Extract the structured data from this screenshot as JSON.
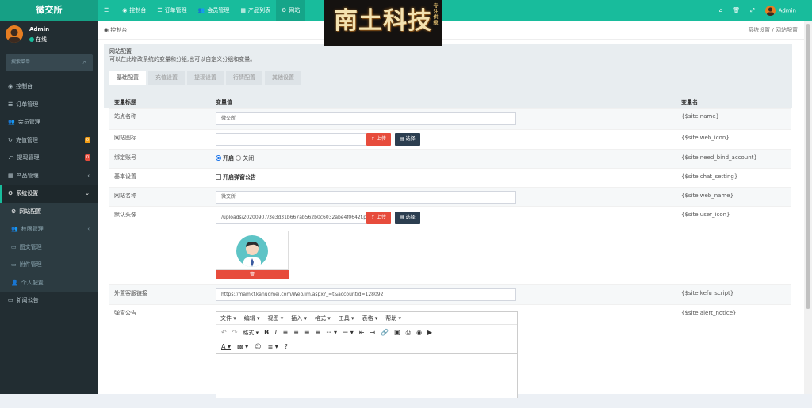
{
  "brand": "微交所",
  "topnav": [
    {
      "icon": "☰",
      "icon_name": "menu-toggle-icon",
      "label": ""
    },
    {
      "icon": "◉",
      "icon_name": "dashboard-icon",
      "label": "控制台"
    },
    {
      "icon": "☰",
      "icon_name": "order-list-icon",
      "label": "订单管理"
    },
    {
      "icon": "👥",
      "icon_name": "users-icon",
      "label": "会员管理"
    },
    {
      "icon": "▦",
      "icon_name": "product-icon",
      "label": "产品列表"
    },
    {
      "icon": "⚙",
      "icon_name": "gear-icon",
      "label": "网站"
    }
  ],
  "topright": {
    "home": "⌂",
    "trash": "🗑",
    "expand": "⤢",
    "user": "Admin"
  },
  "logo_overlay": {
    "text": "南土科技",
    "small": "专注供级"
  },
  "sidebar": {
    "user_name": "Admin",
    "user_status": "在线",
    "search_placeholder": "搜索菜单",
    "items": [
      {
        "icon": "◉",
        "icon_name": "dashboard-icon",
        "label": "控制台"
      },
      {
        "icon": "☰",
        "icon_name": "list-icon",
        "label": "订单管理"
      },
      {
        "icon": "👥",
        "icon_name": "users-icon",
        "label": "会员管理"
      },
      {
        "icon": "↻",
        "icon_name": "recharge-icon",
        "label": "充值管理",
        "badge": "0"
      },
      {
        "icon": "⤺",
        "icon_name": "withdraw-icon",
        "label": "提现管理",
        "badge": "0"
      },
      {
        "icon": "▦",
        "icon_name": "product-icon",
        "label": "产品管理"
      },
      {
        "icon": "⚙",
        "icon_name": "gear-icon",
        "label": "系统设置"
      },
      {
        "icon": "⚙",
        "icon_name": "gear-icon",
        "label": "网站配置"
      },
      {
        "icon": "👥",
        "icon_name": "permission-icon",
        "label": "权限管理"
      },
      {
        "icon": "▭",
        "icon_name": "article-icon",
        "label": "图文管理"
      },
      {
        "icon": "▭",
        "icon_name": "attachment-icon",
        "label": "附件管理"
      },
      {
        "icon": "👤",
        "icon_name": "user-icon",
        "label": "个人配置"
      },
      {
        "icon": "▭",
        "icon_name": "news-icon",
        "label": "新闻公告"
      }
    ]
  },
  "breadcrumb": {
    "home": "控制台",
    "path1": "系统设置",
    "sep": "/",
    "path2": "网站配置"
  },
  "panel": {
    "title": "网站配置",
    "desc": "可以在此增改系统的变量和分组,也可以自定义分组和变量。",
    "tabs": [
      "基础配置",
      "充值设置",
      "提现设置",
      "行情配置",
      "其他设置"
    ]
  },
  "table": {
    "headers": [
      "变量标题",
      "变量值",
      "变量名"
    ],
    "site_name": {
      "title": "站点名称",
      "value": "微交所",
      "var": "{$site.name}"
    },
    "web_icon": {
      "title": "网站图标",
      "value": "",
      "var": "{$site.web_icon}"
    },
    "bind_account": {
      "title": "绑定账号",
      "on": "开启",
      "off": "关闭",
      "var": "{$site.need_bind_account}"
    },
    "basic": {
      "title": "基本设置",
      "check": "开启弹窗公告",
      "var": "{$site.chat_setting}"
    },
    "web_name": {
      "title": "网站名称",
      "value": "微交所",
      "var": "{$site.web_name}"
    },
    "avatar": {
      "title": "默认头像",
      "value": "/uploads/20200907/3e3d31b667ab562b0c6032abe4f0642f.pr",
      "var": "{$site.user_icon}"
    },
    "kefu": {
      "title": "外置客服链接",
      "value": "https://mamkf.kanuomei.com/Web/im.aspx?_=t&accountid=128092",
      "var": "{$site.kefu_script}"
    },
    "notice": {
      "title": "弹窗公告",
      "var": "{$site.alert_notice}"
    },
    "upload_label": "上传",
    "select_label": "选择"
  },
  "editor": {
    "menu": [
      "文件",
      "编辑",
      "视图",
      "插入",
      "格式",
      "工具",
      "表格",
      "帮助"
    ],
    "format_label": "格式"
  },
  "colors": {
    "accent": "#18bc9c",
    "sidebar": "#222d32",
    "danger": "#e74c3c",
    "dark": "#2c3e50"
  }
}
